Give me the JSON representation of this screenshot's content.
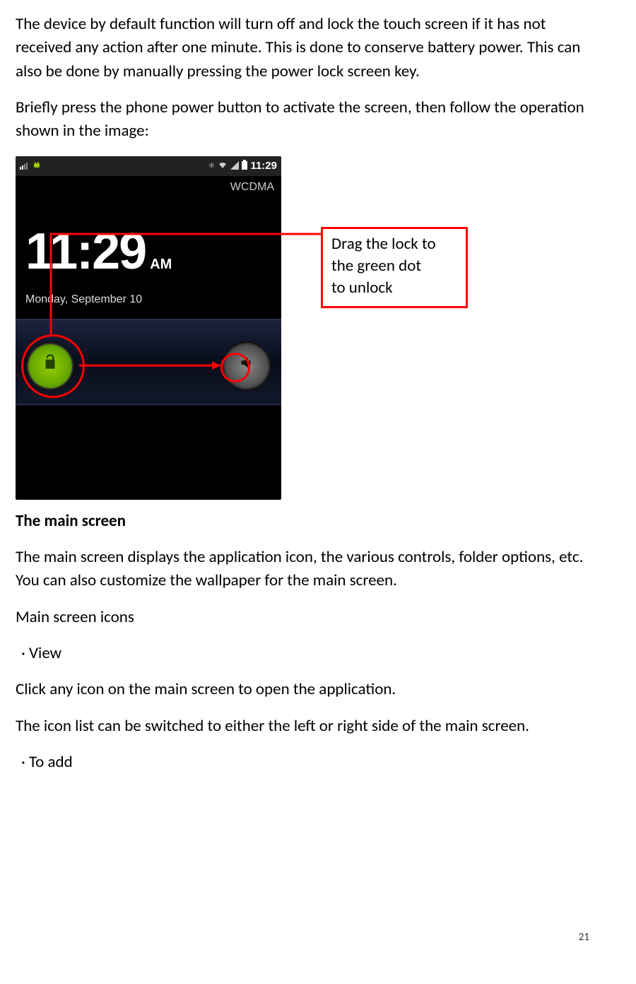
{
  "paragraphs": {
    "p1": "The device by default function will turn off and lock the touch screen if it has not received any action after one minute. This is done to conserve battery power. This can also be done by manually pressing the power lock screen key.",
    "p2": "Briefly press the phone power button to activate the screen, then follow the operation shown in the image:",
    "h1": "The main screen",
    "p3": "The main screen displays the application icon, the various controls, folder options, etc. You can also customize the wallpaper for the main screen.",
    "p4": "Main screen icons",
    "b1": "· View",
    "p5": "Click any icon on the main screen to open the application.",
    "p6": "The icon list can be switched to either the left or right side of the main screen.",
    "b2": "· To add"
  },
  "callout": {
    "l1": "Drag the lock to",
    "l2": "the green dot",
    "l3": "to unlock"
  },
  "phone": {
    "status_time": "11:29",
    "network": "WCDMA",
    "big_time": "11:29",
    "ampm": "AM",
    "date": "Monday, September 10"
  },
  "page_number": "21"
}
